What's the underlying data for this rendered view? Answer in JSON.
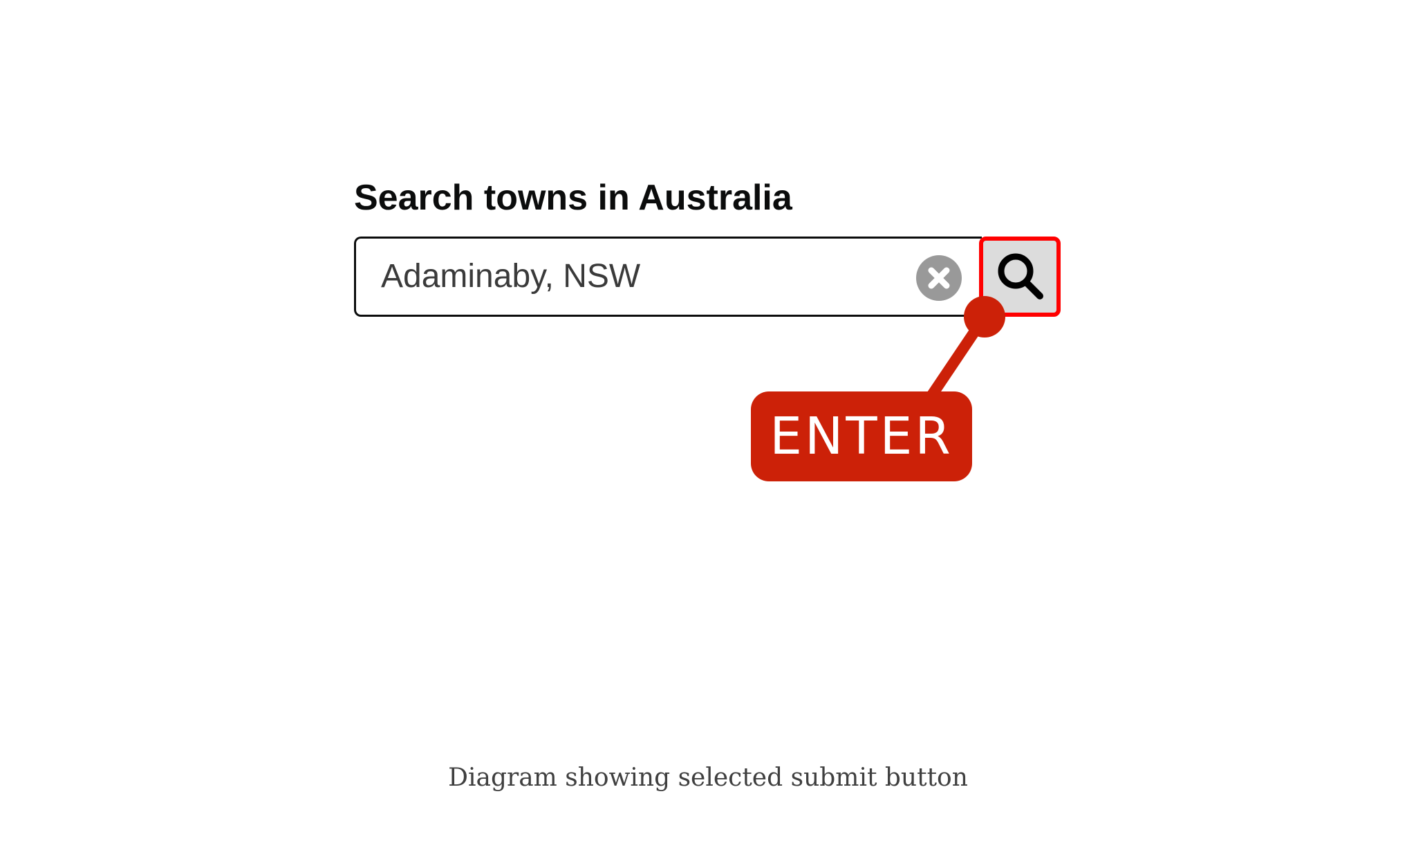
{
  "search": {
    "label": "Search towns in Australia",
    "value": "Adaminaby, NSW"
  },
  "icons": {
    "clear": "close-circle-icon",
    "submit": "magnifying-glass-icon"
  },
  "annotation": {
    "key_label": "ENTER"
  },
  "caption": "Diagram showing selected submit button",
  "colors": {
    "highlight_border": "#ff0000",
    "annotation_red": "#cc2108",
    "submit_background": "#dcdcdc",
    "clear_icon_grey": "#999999",
    "text": "#0b0c0c"
  }
}
